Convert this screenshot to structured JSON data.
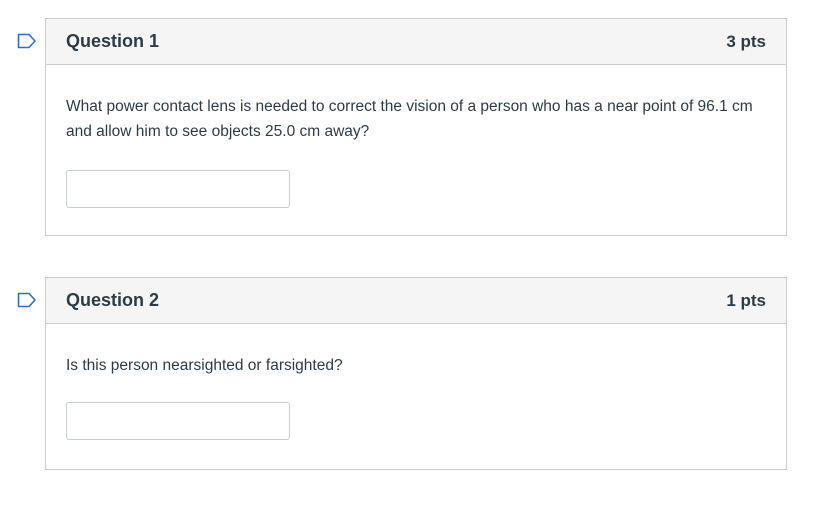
{
  "questions": [
    {
      "title": "Question 1",
      "points": "3 pts",
      "text": "What power contact lens is needed to correct the vision of a person who has a near point of 96.1 cm and allow him to see objects 25.0 cm away?",
      "answer_value": ""
    },
    {
      "title": "Question 2",
      "points": "1 pts",
      "text": "Is this person nearsighted or farsighted?",
      "answer_value": ""
    }
  ],
  "colors": {
    "flag_accent": "#2d6fc7",
    "border": "#c7cdd1",
    "header_bg": "#f5f5f5",
    "text": "#2d3b45"
  },
  "icons": {
    "flag": "bookmark-flag-icon"
  }
}
